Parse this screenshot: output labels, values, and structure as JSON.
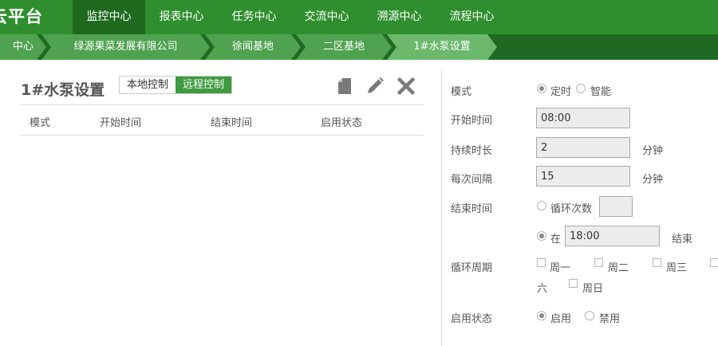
{
  "brand": "云平台",
  "nav": [
    "监控中心",
    "报表中心",
    "任务中心",
    "交流中心",
    "溯源中心",
    "流程中心"
  ],
  "breadcrumb": [
    "中心",
    "绿源果菜发展有限公司",
    "徐闻基地",
    "二区基地",
    "1#水泵设置"
  ],
  "panel": {
    "title": "1#水泵设置",
    "tabs": [
      "本地控制",
      "远程控制"
    ],
    "active_tab": "远程控制",
    "columns": [
      "模式",
      "开始时间",
      "结束时间",
      "启用状态"
    ],
    "icons": [
      "document-icon",
      "pencil-icon",
      "close-icon"
    ]
  },
  "form": {
    "mode_label": "模式",
    "mode_options": [
      "定时",
      "智能"
    ],
    "mode_selected": "定时",
    "start_label": "开始时间",
    "start_value": "08:00",
    "duration_label": "持续时长",
    "duration_value": "2",
    "duration_unit": "分钟",
    "interval_label": "每次间隔",
    "interval_value": "15",
    "interval_unit": "分钟",
    "end_label": "结束时间",
    "end_option_loop": "循环次数",
    "loop_value": "",
    "end_option_at": "在",
    "end_at_value": "18:00",
    "end_suffix": "结束",
    "cycle_label": "循环周期",
    "cycle_days": [
      "周一",
      "周二",
      "周三"
    ],
    "cycle_wrap": "六",
    "cycle_sunday": "周日",
    "enable_label": "启用状态",
    "enable_options": [
      "启用",
      "禁用"
    ],
    "enable_selected": "启用"
  },
  "colors": {
    "nav_bg": "#2f8f2f",
    "nav_active": "#1f6a1f",
    "crumb": "#4fa24f",
    "crumb_last": "#6cb86c",
    "tab_active": "#3f9b3f"
  }
}
